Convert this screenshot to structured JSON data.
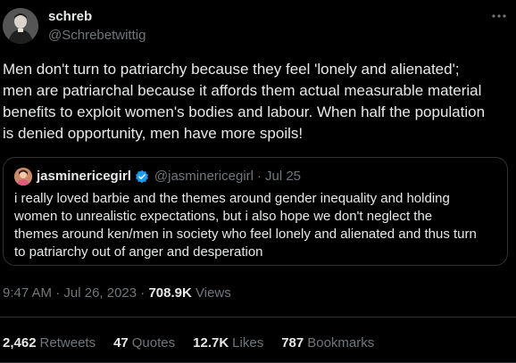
{
  "author": {
    "name": "schreb",
    "handle": "@Schrebetwittig"
  },
  "tweet": {
    "lines": [
      "Men don't turn to patriarchy because they feel 'lonely and alienated';",
      "men are patriarchal because it affords them actual measurable material",
      "benefits to exploit women's bodies and labour. When half the population",
      "is denied opportunity, men have more spoils!"
    ]
  },
  "quote": {
    "name": "jasminericegirl",
    "handle": "@jasminericegirl",
    "dot": "·",
    "date": "Jul 25",
    "verified_color": "#1d9bf0",
    "lines": [
      "i really loved barbie and the themes around gender inequality and holding",
      "women to unrealistic expectations, but i also hope we don't neglect the",
      "themes around ken/men in society who feel lonely and alienated and thus turn",
      "to patriarchy out of anger and desperation"
    ]
  },
  "meta": {
    "time": "9:47 AM",
    "dot1": "·",
    "date": "Jul 26, 2023",
    "dot2": "·",
    "views_count": "708.9K",
    "views_label": "Views"
  },
  "stats": [
    {
      "count": "2,462",
      "label": "Retweets"
    },
    {
      "count": "47",
      "label": "Quotes"
    },
    {
      "count": "12.7K",
      "label": "Likes"
    },
    {
      "count": "787",
      "label": "Bookmarks"
    }
  ],
  "icons": {
    "more": "more-horizontal-icon",
    "verified": "verified-badge-icon"
  }
}
